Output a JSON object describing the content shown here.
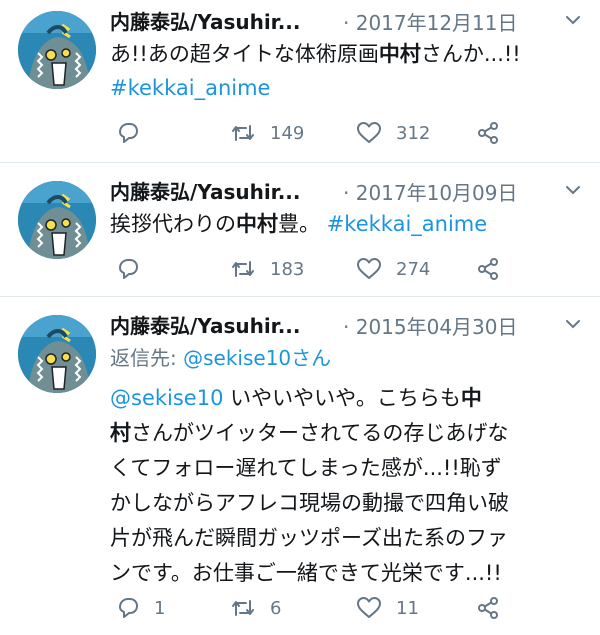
{
  "tweets": [
    {
      "user": "内藤泰弘/Yasuhir...",
      "date": "· 2017年12月11日",
      "text_a": "あ!!あの超タイトな体術原画",
      "text_b": "中村",
      "text_c": "さんか...!!",
      "hashtag": "#kekkai_anime",
      "replies": "",
      "retweets": "149",
      "likes": "312"
    },
    {
      "user": "内藤泰弘/Yasuhir...",
      "date": "· 2017年10月09日",
      "text_a": "挨拶代わりの",
      "text_b": "中村",
      "text_c": "豊。",
      "hashtag": "#kekkai_anime",
      "replies": "",
      "retweets": "183",
      "likes": "274"
    },
    {
      "user": "内藤泰弘/Yasuhir...",
      "date": "· 2015年04月30日",
      "reply_to_label": "返信先:",
      "reply_to_user": "@sekise10さん",
      "mention": "@sekise10",
      "line1_a": " いやいやいや。こちらも",
      "line1_b": "中",
      "line2_a": "村",
      "line2_b": "さんがツイッターされてるの存じあげな",
      "line3": "くてフォロー遅れてしまった感が...!!恥ず",
      "line4": "かしながらアフレコ現場の動撮で四角い破",
      "line5": "片が飛んだ瞬間ガッツポーズ出た系のファ",
      "line6": "ンです。お仕事ご一緒できて光栄です...!!",
      "replies": "1",
      "retweets": "6",
      "likes": "11"
    }
  ],
  "icons": {
    "reply": "reply-icon",
    "retweet": "retweet-icon",
    "like": "heart-icon",
    "share": "share-icon",
    "menu": "chevron-down-icon"
  },
  "colors": {
    "link": "#1b95e0",
    "muted": "#657786",
    "text": "#14171a",
    "divider": "#e1e8ed"
  }
}
